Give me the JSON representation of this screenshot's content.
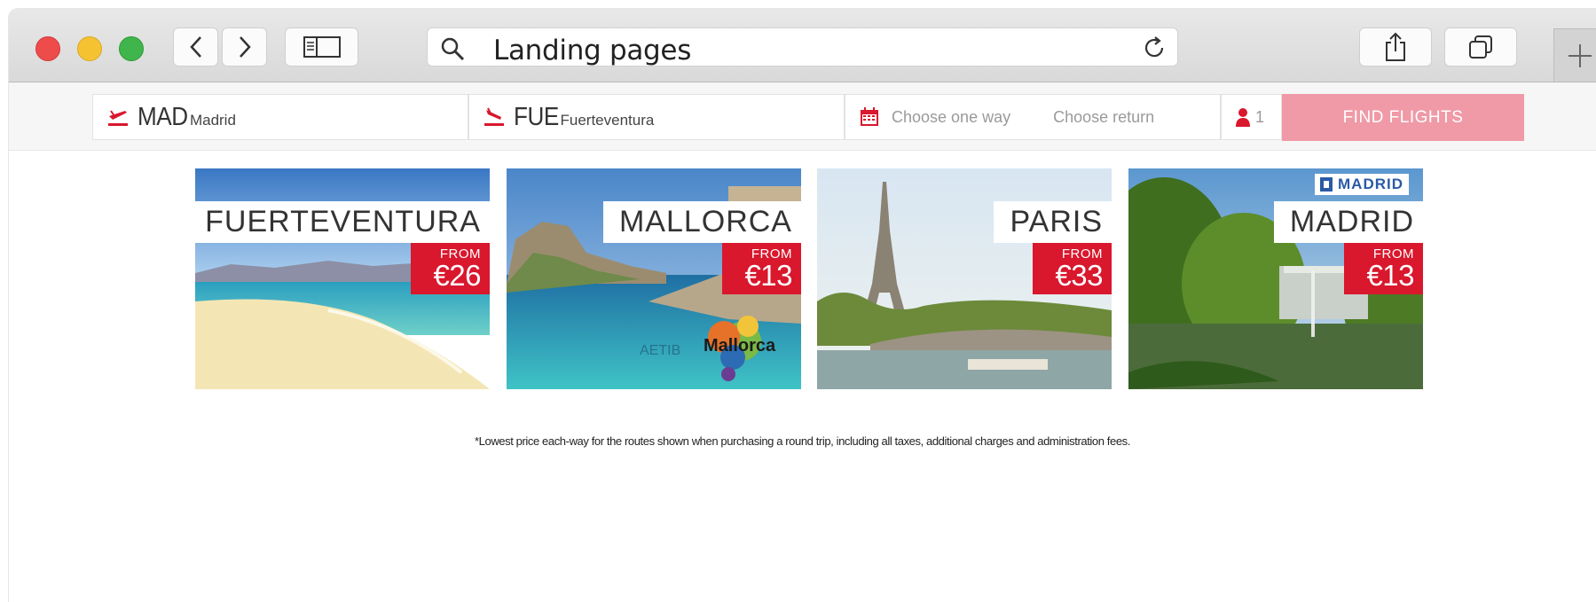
{
  "browser": {
    "address_text": "Landing pages",
    "icons": [
      "close-light",
      "minimize-light",
      "zoom-light",
      "back-icon",
      "forward-icon",
      "sidebar-icon",
      "search-icon",
      "reload-icon",
      "share-icon",
      "tabs-icon",
      "plus-icon"
    ]
  },
  "booking": {
    "origin_code": "MAD",
    "origin_city": "Madrid",
    "destination_code": "FUE",
    "destination_city": "Fuerteventura",
    "depart_placeholder": "Choose one way",
    "return_placeholder": "Choose return",
    "passengers": "1",
    "find_button": "FIND FLIGHTS",
    "accent_color": "#d9172d",
    "button_color": "#ef9aa6"
  },
  "destinations": [
    {
      "name": "FUERTEVENTURA",
      "from_label": "FROM",
      "price": "€26"
    },
    {
      "name": "MALLORCA",
      "from_label": "FROM",
      "price": "€13",
      "logo_text": "Mallorca",
      "watermark": "AETIB"
    },
    {
      "name": "PARIS",
      "from_label": "FROM",
      "price": "€33"
    },
    {
      "name": "MADRID",
      "from_label": "FROM",
      "price": "€13",
      "badge": "MADRID"
    }
  ],
  "footnote": "*Lowest price each-way for the routes shown when purchasing a round trip, including all taxes, additional charges and administration fees."
}
